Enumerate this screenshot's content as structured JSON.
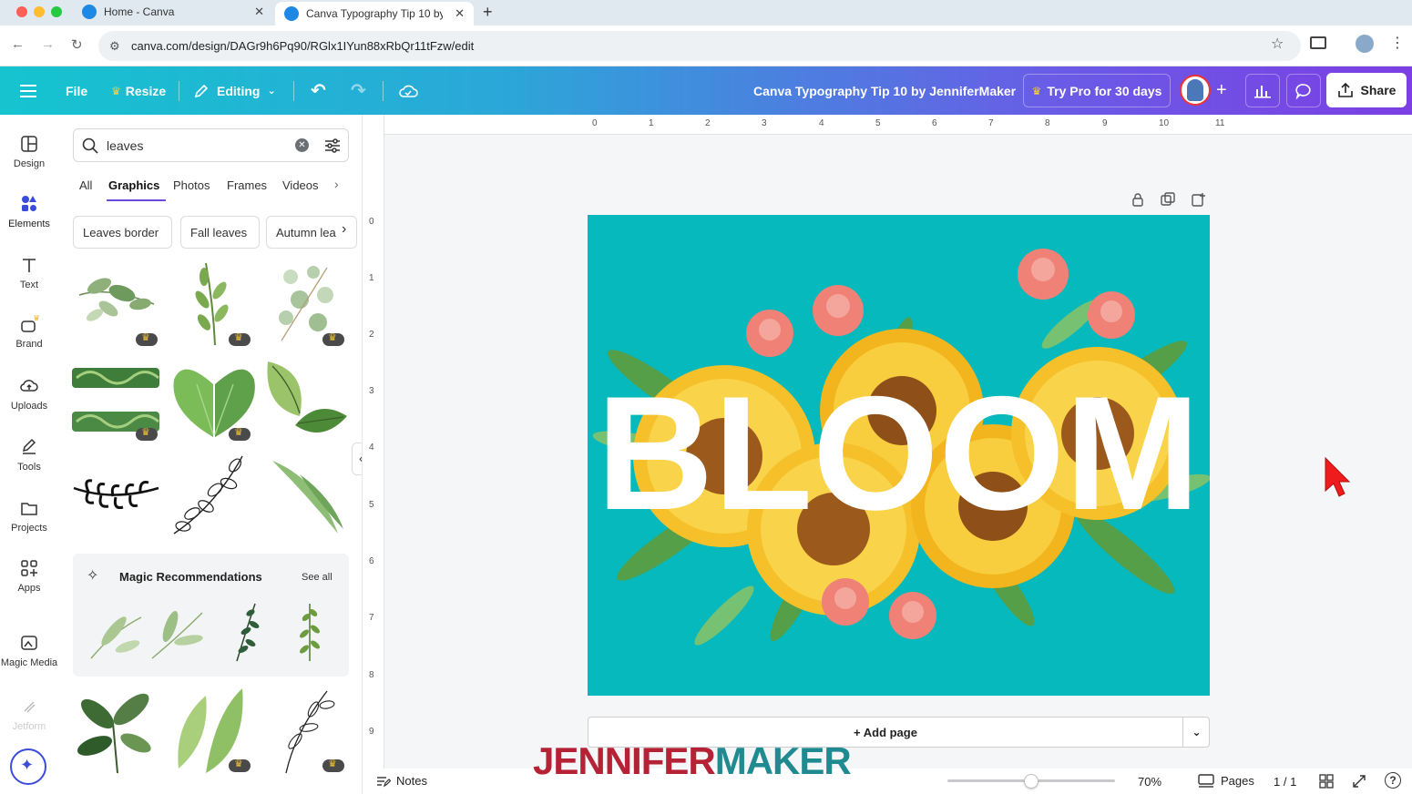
{
  "browser": {
    "tabs": [
      {
        "title": "Home - Canva"
      },
      {
        "title": "Canva Typography Tip 10 by ..."
      }
    ],
    "url": "canva.com/design/DAGr9h6Pq90/RGlx1IYun88xRbQr11tFzw/edit"
  },
  "header": {
    "file_label": "File",
    "resize_label": "Resize",
    "editing_label": "Editing",
    "doc_title": "Canva Typography Tip 10 by JenniferMaker",
    "pro_label": "Try Pro for 30 days",
    "share_label": "Share",
    "gradient_start": "#15c4cf",
    "gradient_end": "#7b3fe4"
  },
  "rail": {
    "items": [
      {
        "label": "Design",
        "icon": "layout-icon"
      },
      {
        "label": "Elements",
        "icon": "shapes-icon"
      },
      {
        "label": "Text",
        "icon": "text-icon"
      },
      {
        "label": "Brand",
        "icon": "brand-icon"
      },
      {
        "label": "Uploads",
        "icon": "cloud-upload-icon"
      },
      {
        "label": "Tools",
        "icon": "pen-icon"
      },
      {
        "label": "Projects",
        "icon": "folder-icon"
      },
      {
        "label": "Apps",
        "icon": "apps-icon"
      },
      {
        "label": "Magic Media",
        "icon": "magic-media-icon"
      },
      {
        "label": "Jetform",
        "icon": "jetform-icon"
      }
    ]
  },
  "panel": {
    "search_value": "leaves",
    "filter_tabs": [
      "All",
      "Graphics",
      "Photos",
      "Frames",
      "Videos"
    ],
    "active_tab": "Graphics",
    "chips": [
      "Leaves border",
      "Fall leaves",
      "Autumn lea"
    ],
    "magic_title": "Magic Recommendations",
    "see_all": "See all"
  },
  "workspace": {
    "ruler_h": [
      "0",
      "1",
      "2",
      "3",
      "4",
      "5",
      "6",
      "7",
      "8",
      "9",
      "10",
      "11"
    ],
    "ruler_v": [
      "0",
      "1",
      "2",
      "3",
      "4",
      "5",
      "6",
      "7",
      "8",
      "9"
    ],
    "canvas_text": "BLOOM",
    "canvas_bg": "#05b9bd",
    "add_page_label": "+ Add page",
    "watermark_a": "JENNIFER",
    "watermark_b": "MAKER",
    "notes_label": "Notes",
    "zoom_label": "70%",
    "zoom_value": 0.5,
    "pages_label": "Pages",
    "page_count": "1 / 1"
  }
}
